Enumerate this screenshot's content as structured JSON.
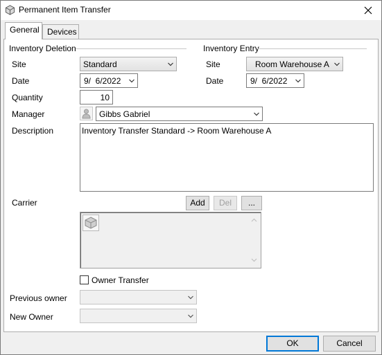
{
  "window": {
    "title": "Permanent Item Transfer"
  },
  "tabs": [
    {
      "label": "General"
    },
    {
      "label": "Devices"
    }
  ],
  "deletion": {
    "group_label": "Inventory Deletion",
    "site_label": "Site",
    "site_value": "Standard",
    "date_label": "Date",
    "date_value": "9/  6/2022",
    "quantity_label": "Quantity",
    "quantity_value": "10"
  },
  "entry": {
    "group_label": "Inventory Entry",
    "site_label": "Site",
    "site_value": "Room Warehouse A",
    "date_label": "Date",
    "date_value": "9/  6/2022"
  },
  "manager": {
    "label": "Manager",
    "value": "Gibbs Gabriel"
  },
  "description": {
    "label": "Description",
    "value": "Inventory Transfer Standard -> Room Warehouse A"
  },
  "carrier": {
    "label": "Carrier",
    "add_label": "Add",
    "del_label": "Del",
    "more_label": "..."
  },
  "owner_transfer": {
    "label": "Owner Transfer",
    "checked": false
  },
  "previous_owner": {
    "label": "Previous owner",
    "value": ""
  },
  "new_owner": {
    "label": "New Owner",
    "value": ""
  },
  "footer": {
    "ok_label": "OK",
    "cancel_label": "Cancel"
  },
  "icons": {
    "app": "box-icon",
    "close": "close-icon",
    "dropdown": "chevron-down-icon",
    "manager": "person-icon",
    "carrier_item": "box-icon"
  }
}
